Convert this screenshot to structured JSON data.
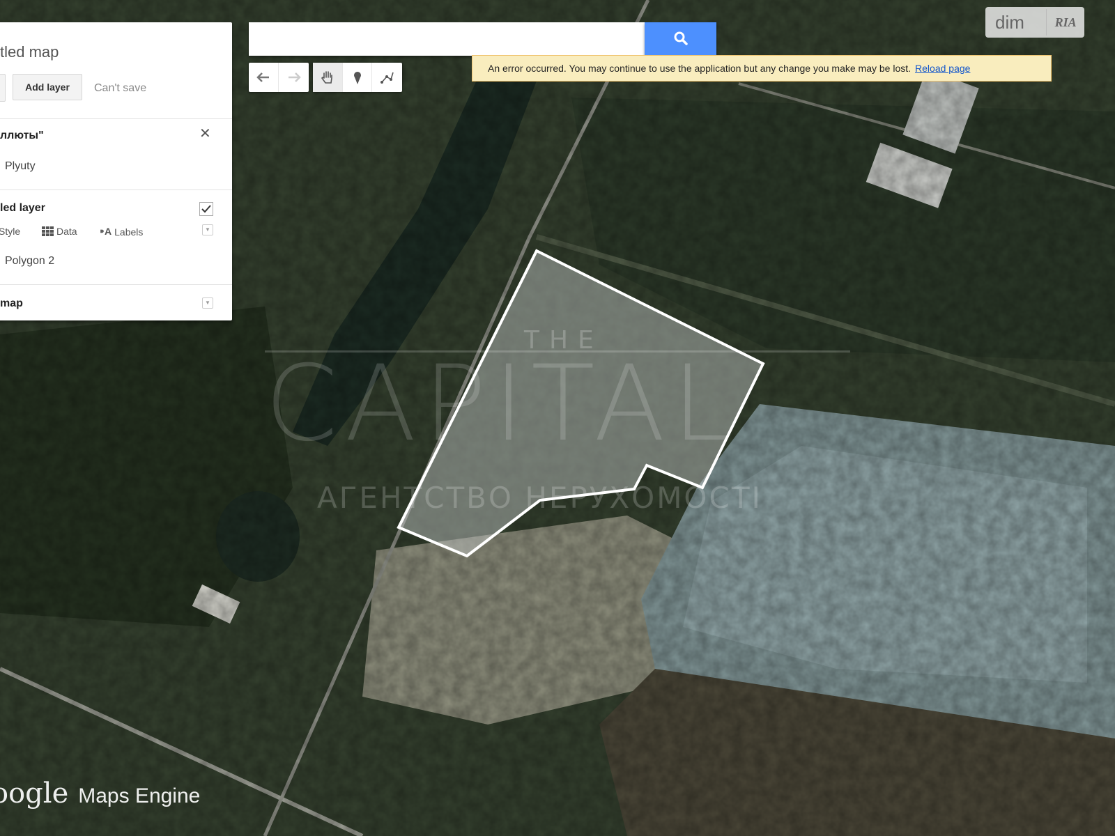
{
  "panel": {
    "map_title": "tled map",
    "add_layer_label": "Add layer",
    "save_status": "Can't save",
    "layer1": {
      "title": "ллюты\"",
      "item": "Plyuty"
    },
    "layer2": {
      "title": "led layer",
      "checked": true,
      "options": {
        "style": "Style",
        "data": "Data",
        "labels": "Labels"
      },
      "item": "Polygon 2"
    },
    "base_map": {
      "title": "map"
    }
  },
  "search": {
    "placeholder": "",
    "value": ""
  },
  "toolbar": {
    "icons": [
      "undo-icon",
      "redo-icon",
      "hand-icon",
      "marker-icon",
      "draw-line-icon"
    ]
  },
  "error_bar": {
    "message": "An error occurred. You may continue to use the application but any change you make may be lost.",
    "link": "Reload page"
  },
  "logo": {
    "text1": "dim",
    "text2": "RIA"
  },
  "watermark": {
    "top": "THE",
    "main": "CAPITAL",
    "sub": "АГЕНТСТВО НЕРУХОМОСТІ"
  },
  "branding": {
    "google": "oogle",
    "product": "Maps Engine"
  },
  "colors": {
    "accent_blue": "#4d90fe",
    "error_bg": "#f9edbe",
    "link": "#1155cc"
  }
}
